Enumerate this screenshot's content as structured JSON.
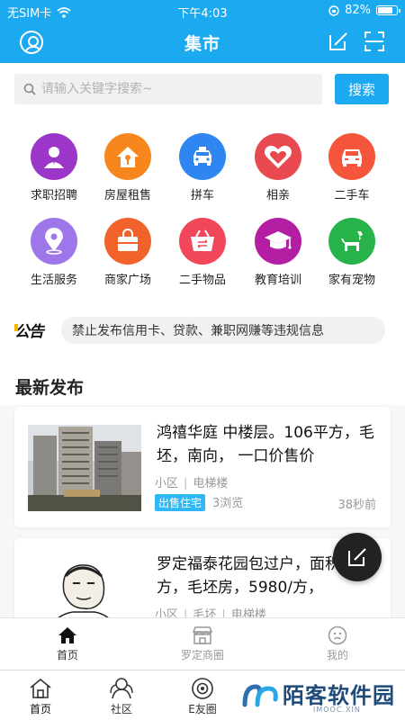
{
  "status": {
    "carrier": "无SIM卡",
    "time": "下午4:03",
    "battery": "82%",
    "battery_level": 0.82
  },
  "header": {
    "title": "集市"
  },
  "search": {
    "placeholder": "请输入关键字搜索~",
    "button": "搜索"
  },
  "categories": [
    {
      "label": "求职招聘",
      "color": "#9b36c9",
      "icon": "job-icon"
    },
    {
      "label": "房屋租售",
      "color": "#f7861c",
      "icon": "house-icon"
    },
    {
      "label": "拼车",
      "color": "#2f86f0",
      "icon": "taxi-icon"
    },
    {
      "label": "相亲",
      "color": "#e84a4f",
      "icon": "heart-icon"
    },
    {
      "label": "二手车",
      "color": "#f5553a",
      "icon": "car-icon"
    },
    {
      "label": "生活服务",
      "color": "#9d77ea",
      "icon": "location-icon"
    },
    {
      "label": "商家广场",
      "color": "#f2622b",
      "icon": "shop-bag-icon"
    },
    {
      "label": "二手物品",
      "color": "#f0485a",
      "icon": "basket-icon"
    },
    {
      "label": "教育培训",
      "color": "#b41ea2",
      "icon": "graduation-cap-icon"
    },
    {
      "label": "家有宠物",
      "color": "#27b24a",
      "icon": "dog-icon"
    }
  ],
  "notice": {
    "badge": "公告",
    "text": "禁止发布信用卡、贷款、兼职网赚等违规信息"
  },
  "latest": {
    "title": "最新发布"
  },
  "posts": [
    {
      "title": "鸿禧华庭 中楼层。106平方，毛坯，南向， 一口价售价",
      "meta": [
        "小区",
        "电梯楼"
      ],
      "tag": "出售住宅",
      "views": "3浏览",
      "time": "38秒前"
    },
    {
      "title": "罗定福泰花园包过户，面积122方，毛坯房，5980/方，",
      "meta": [
        "小区",
        "毛坯",
        "电梯楼"
      ]
    }
  ],
  "tabs_inner": [
    {
      "label": "首页",
      "icon": "home-filled-icon",
      "active": true
    },
    {
      "label": "罗定商圈",
      "icon": "store-icon",
      "active": false
    },
    {
      "label": "我的",
      "icon": "face-icon",
      "active": false
    }
  ],
  "tabs_outer": [
    {
      "label": "首页",
      "icon": "home-outline-icon"
    },
    {
      "label": "社区",
      "icon": "community-icon"
    },
    {
      "label": "E友圈",
      "icon": "circle-icon"
    }
  ],
  "watermark": {
    "name": "陌客软件园",
    "sub": "IMOOC.XIN"
  }
}
